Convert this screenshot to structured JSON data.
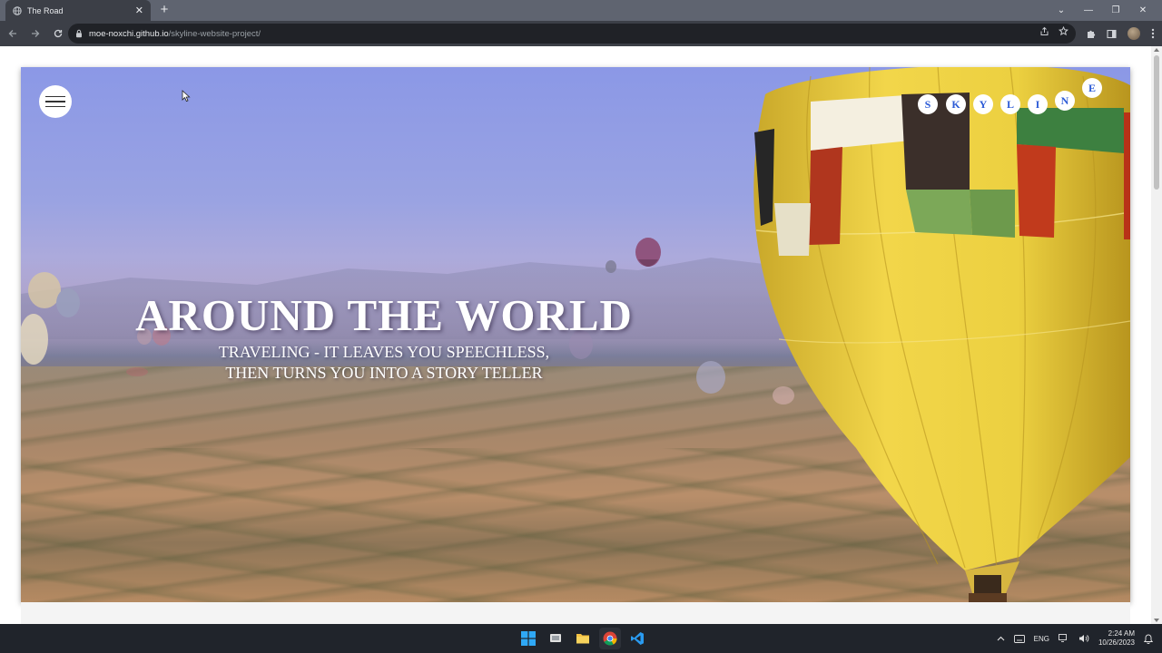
{
  "browser": {
    "tab_title": "The Road",
    "new_tab": "+",
    "tab_close": "✕",
    "url_host": "moe-noxchi.github.io",
    "url_path": "/skyline-website-project/"
  },
  "window_controls": {
    "minimize": "—",
    "restore": "❐",
    "close": "✕",
    "tab_search": "⌄"
  },
  "hero": {
    "brand_letters": [
      "S",
      "K",
      "Y",
      "L",
      "I",
      "N",
      "E"
    ],
    "headline": "AROUND THE WORLD",
    "subline_1": "TRAVELING - IT LEAVES YOU SPEECHLESS,",
    "subline_2": "THEN TURNS YOU INTO A STORY TELLER"
  },
  "taskbar": {
    "lang": "ENG",
    "time": "2:24 AM",
    "date": "10/26/2023"
  },
  "colors": {
    "sky_top": "#8b98e6",
    "brand_letter": "#2c5bd6",
    "balloon_yellow": "#f0d040",
    "chrome_dark": "#3c3f47",
    "taskbar": "#20242b"
  }
}
